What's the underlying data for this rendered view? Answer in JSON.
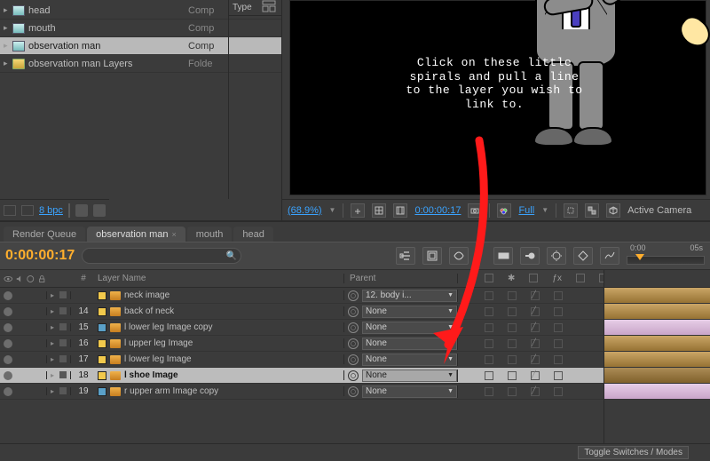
{
  "project": {
    "type_hdr": "Type",
    "items": [
      {
        "name": "head",
        "type": "Comp",
        "icon": "comp",
        "arrow": true
      },
      {
        "name": "mouth",
        "type": "Comp",
        "icon": "comp",
        "arrow": true
      },
      {
        "name": "observation man",
        "type": "Comp",
        "icon": "comp",
        "arrow": true,
        "selected": true
      },
      {
        "name": "observation man Layers",
        "type": "Folde",
        "icon": "folder",
        "arrow": true
      }
    ],
    "footer_bpc": "8 bpc"
  },
  "preview": {
    "annotation": "Click on these little spirals and pull a line to the layer you wish to link to.",
    "zoom": "(68.9%)",
    "timecode": "0:00:00:17",
    "res": "Full",
    "camera": "Active Camera"
  },
  "timeline": {
    "tabs": [
      {
        "label": "Render Queue"
      },
      {
        "label": "observation man",
        "active": true,
        "closeable": true
      },
      {
        "label": "mouth"
      },
      {
        "label": "head"
      }
    ],
    "timecode": "0:00:00:17",
    "ruler": {
      "start": "0:00",
      "mark": "05s"
    },
    "cols": {
      "num": "#",
      "name": "Layer Name",
      "parent": "Parent"
    },
    "layers": [
      {
        "num": "",
        "name": "neck image",
        "parent_label": "12. body i...",
        "color": "y",
        "cut": true
      },
      {
        "num": "14",
        "name": "back of neck",
        "parent_label": "None",
        "color": "y"
      },
      {
        "num": "15",
        "name": "l lower leg Image copy",
        "parent_label": "None",
        "color": "b"
      },
      {
        "num": "16",
        "name": "l upper leg Image",
        "parent_label": "None",
        "color": "y"
      },
      {
        "num": "17",
        "name": "l lower leg Image",
        "parent_label": "None",
        "color": "y"
      },
      {
        "num": "18",
        "name": "l shoe Image",
        "parent_label": "None",
        "color": "y",
        "selected": true
      },
      {
        "num": "19",
        "name": "r upper arm Image copy",
        "parent_label": "None",
        "color": "b"
      }
    ],
    "toggle_label": "Toggle Switches / Modes"
  }
}
